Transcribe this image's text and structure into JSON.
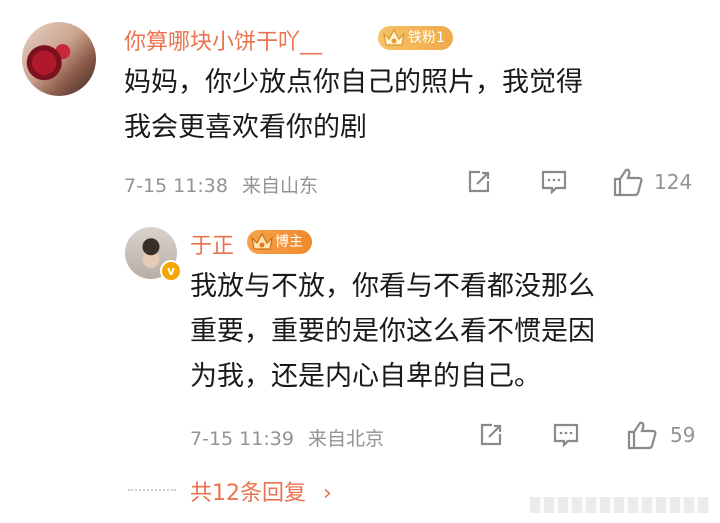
{
  "comment": {
    "username": "你算哪块小饼干吖__",
    "fan_badge": "铁粉1",
    "text_line1": "妈妈，你少放点你自己的照片，我觉得",
    "text_line2": "我会更喜欢看你的剧",
    "time": "7-15 11:38",
    "location": "来自山东",
    "like_count": "124"
  },
  "reply": {
    "username": "于正",
    "badge": "博主",
    "verified_mark": "v",
    "text_line1": "我放与不放，你看与不看都没那么",
    "text_line2": "重要，重要的是你这么看不惯是因",
    "text_line3": "为我，还是内心自卑的自己。",
    "time": "7-15 11:39",
    "location": "来自北京",
    "like_count": "59"
  },
  "more_replies": "共12条回复",
  "more_chevron": "›",
  "colors": {
    "username": "#eb7350",
    "meta": "#939393",
    "badge_gold": "#f0a94a",
    "badge_orange": "#f08a2d"
  },
  "icons": [
    "share-icon",
    "comment-icon",
    "like-icon",
    "crown-icon",
    "chevron-right-icon"
  ]
}
